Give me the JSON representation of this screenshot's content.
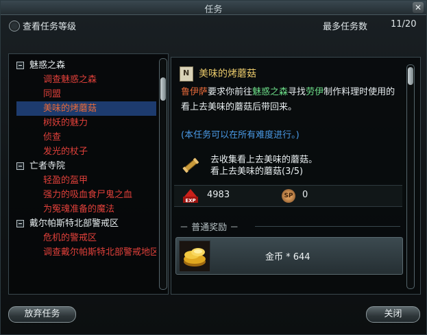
{
  "window": {
    "title": "任务",
    "close_symbol": "✕"
  },
  "header": {
    "show_quest_level_label": "查看任务等级",
    "max_quests_label": "最多任务数",
    "max_quests_value": "11/20"
  },
  "quest_tree": [
    {
      "category": "魅惑之森",
      "quests": [
        "调查魅惑之森",
        "同盟",
        "美味的烤蘑菇",
        "树妖的魅力",
        "侦查",
        "发光的杖子"
      ]
    },
    {
      "category": "亡者寺院",
      "quests": [
        "轻盈的盔甲",
        "强力的吸血食尸鬼之血",
        "为冤魂准备的魔法"
      ]
    },
    {
      "category": "戴尔帕斯特北部警戒区",
      "quests": [
        "危机的警戒区",
        "调查戴尔帕斯特北部警戒地区"
      ]
    }
  ],
  "selected_quest_index": 2,
  "detail": {
    "icon_letter": "N",
    "title": "美味的烤蘑菇",
    "desc_npc1": "鲁伊萨",
    "desc_part1": "要求你前往",
    "desc_location": "魅惑之森",
    "desc_part2": "寻找",
    "desc_npc2": "劳伊",
    "desc_part3": "制作料理时使用的看上去美味的蘑菇后带回来。",
    "difficulty_note": "(本任务可以在所有难度进行。)",
    "objective_line1": "去收集看上去美味的蘑菇。",
    "objective_line2": "看上去美味的蘑菇(3/5)",
    "exp_icon_label": "EXP",
    "exp_value": "4983",
    "sp_icon_label": "SP",
    "sp_value": "0",
    "reward_section_label": "－ 普通奖励 －",
    "gold_reward": "金币 * 644"
  },
  "buttons": {
    "abandon": "放弃任务",
    "close": "关闭"
  }
}
